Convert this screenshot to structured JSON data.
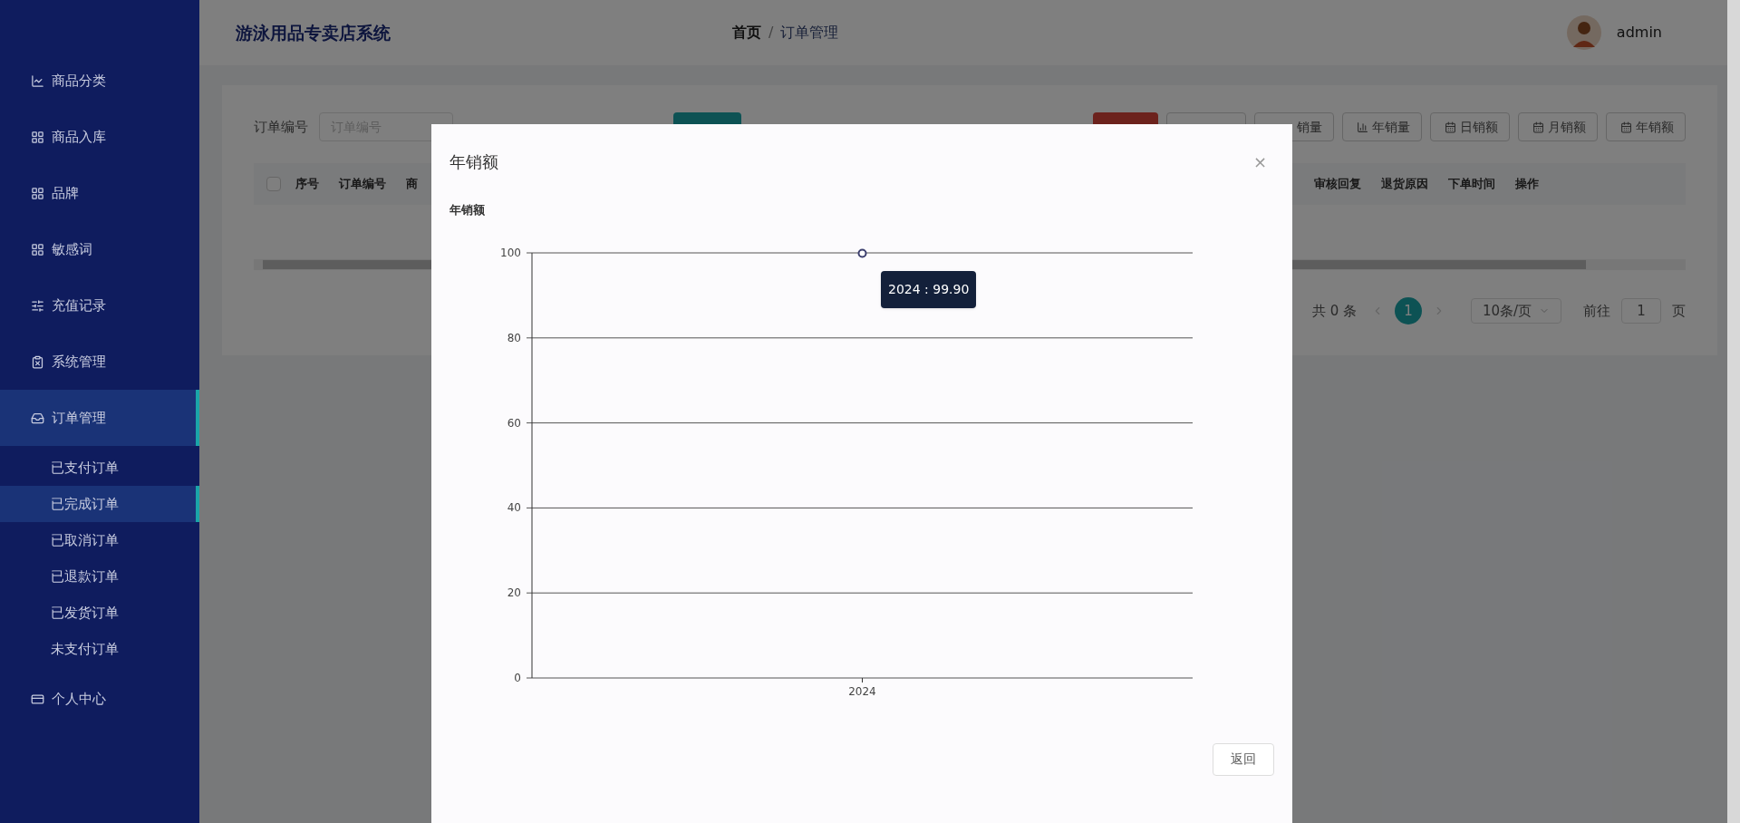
{
  "sidebar": {
    "items": [
      {
        "label": "商品分类",
        "selected": false
      },
      {
        "label": "商品入库",
        "selected": false
      },
      {
        "label": "品牌",
        "selected": false
      },
      {
        "label": "敏感词",
        "selected": false
      },
      {
        "label": "充值记录",
        "selected": false
      },
      {
        "label": "系统管理",
        "selected": false
      },
      {
        "label": "订单管理",
        "selected": true,
        "expanded": true,
        "children": [
          {
            "label": "已支付订单",
            "selected": false
          },
          {
            "label": "已完成订单",
            "selected": true
          },
          {
            "label": "已取消订单",
            "selected": false
          },
          {
            "label": "已退款订单",
            "selected": false
          },
          {
            "label": "已发货订单",
            "selected": false
          },
          {
            "label": "未支付订单",
            "selected": false
          }
        ]
      },
      {
        "label": "个人中心",
        "selected": false
      }
    ]
  },
  "header": {
    "title": "游泳用品专卖店系统",
    "breadcrumb": [
      "首页",
      "订单管理"
    ],
    "separator": "/",
    "user": "admin"
  },
  "search": {
    "label": "订单编号",
    "placeholder": "订单编号"
  },
  "toolbar": [
    {
      "kind": "danger"
    },
    {
      "kind": "plain"
    },
    {
      "kind": "plain",
      "label": "销量"
    },
    {
      "kind": "plain",
      "label": "年销量"
    },
    {
      "kind": "plain",
      "label": "日销额"
    },
    {
      "kind": "plain",
      "label": "月销额"
    },
    {
      "kind": "plain",
      "label": "年销额"
    }
  ],
  "table": {
    "select_all": {
      "checked": false
    },
    "columns_left": [
      "序号",
      "订单编号",
      "商"
    ],
    "columns_right": [
      "审核回复",
      "退货原因",
      "下单时间",
      "操作"
    ]
  },
  "pagination": {
    "total": "共 0 条",
    "current_page": "1",
    "page_size": "10条/页",
    "goto_label": "前往",
    "goto_value": "1",
    "goto_suffix": "页"
  },
  "dialog": {
    "title": "年销额",
    "close": "×",
    "tooltip": "2024 : 99.90",
    "return_button": "返回",
    "chart_data": {
      "type": "line",
      "title": "年销额",
      "categories": [
        "2024"
      ],
      "grid": true,
      "series": [
        {
          "color": "#3c3f6e",
          "marker": true,
          "values": [
            99.9
          ]
        }
      ],
      "ylim": [
        0,
        100
      ],
      "yticks": [
        0,
        20,
        40,
        60,
        80,
        100
      ]
    }
  }
}
